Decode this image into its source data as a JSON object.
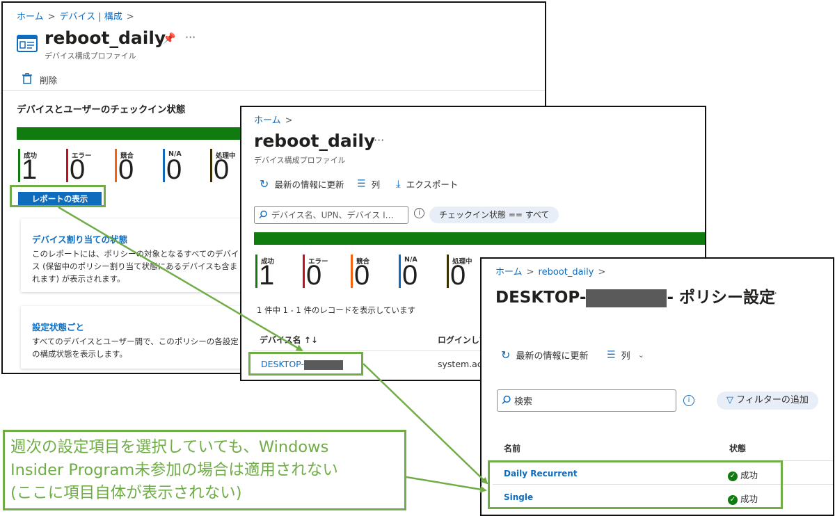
{
  "panel1": {
    "breadcrumb": [
      "ホーム",
      "デバイス | 構成"
    ],
    "title": "reboot_daily",
    "subtitle": "デバイス構成プロファイル",
    "delete_label": "削除",
    "section_title": "デバイスとユーザーのチェックイン状態",
    "stats": [
      {
        "label": "成功",
        "value": "1",
        "color": "#107c10"
      },
      {
        "label": "エラー",
        "value": "0",
        "color": "#c50f1f"
      },
      {
        "label": "競合",
        "value": "0",
        "color": "#f7630c"
      },
      {
        "label": "N/A",
        "value": "0",
        "color": "#0f6cbd"
      },
      {
        "label": "処理中",
        "value": "0",
        "color": "#3b2e00"
      }
    ],
    "report_button": "レポートの表示",
    "cards": [
      {
        "title": "デバイス割り当ての状態",
        "desc": "このレポートには、ポリシーの対象となるすべてのデバイス (保留中のポリシー割り当て状態にあるデバイスも含まれます) が表示されます。"
      },
      {
        "title": "設定状態ごと",
        "desc": "すべてのデバイスとユーザー間で、このポリシーの各設定の構成状態を表示します。"
      }
    ]
  },
  "panel2": {
    "breadcrumb": [
      "ホーム"
    ],
    "title": "reboot_daily",
    "subtitle": "デバイス構成プロファイル",
    "toolbar": {
      "refresh": "最新の情報に更新",
      "columns": "列",
      "export": "エクスポート"
    },
    "search_placeholder": "デバイス名、UPN、デバイス I…",
    "filter_pill": "チェックイン状態 == すべて",
    "stats": [
      {
        "label": "成功",
        "value": "1",
        "color": "#107c10"
      },
      {
        "label": "エラー",
        "value": "0",
        "color": "#c50f1f"
      },
      {
        "label": "競合",
        "value": "0",
        "color": "#f7630c"
      },
      {
        "label": "N/A",
        "value": "0",
        "color": "#0f6cbd"
      },
      {
        "label": "処理中",
        "value": "0",
        "color": "#3b2e00"
      }
    ],
    "record_count": "1 件中 1 - 1 件のレコードを表示しています",
    "columns": [
      "デバイス名 ↑↓",
      "ログインして"
    ],
    "row": {
      "device": "DESKTOP-",
      "login": "system.ac"
    }
  },
  "panel3": {
    "breadcrumb": [
      "ホーム",
      "reboot_daily"
    ],
    "title_prefix": "DESKTOP-",
    "title_suffix": "- ポリシー設定",
    "toolbar": {
      "refresh": "最新の情報に更新",
      "columns": "列"
    },
    "search_placeholder": "検索",
    "filter_button": "フィルターの追加",
    "columns": [
      "名前",
      "状態"
    ],
    "rows": [
      {
        "name": "Daily Recurrent",
        "status": "成功"
      },
      {
        "name": "Single",
        "status": "成功"
      }
    ]
  },
  "annotation": {
    "lines": [
      "週次の設定項目を選択していても、Windows",
      "Insider Program未参加の場合は適用されない",
      "(ここに項目自体が表示されない)"
    ],
    "color": "#70ad47"
  }
}
